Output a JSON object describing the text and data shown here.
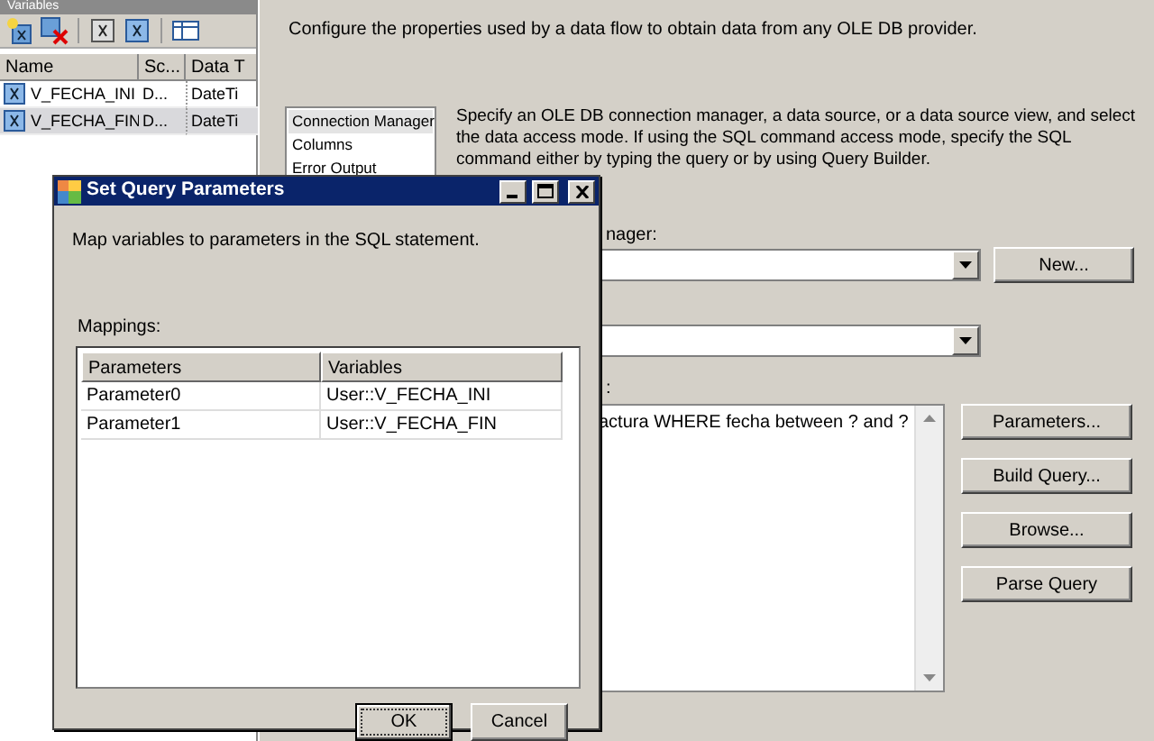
{
  "variables_panel": {
    "title": "Variables",
    "columns": [
      "Name",
      "Sc...",
      "Data T"
    ],
    "rows": [
      {
        "name": "V_FECHA_INI",
        "scope": "D...",
        "data_type": "DateTi",
        "selected": false
      },
      {
        "name": "V_FECHA_FIN",
        "scope": "D...",
        "data_type": "DateTi",
        "selected": true
      }
    ]
  },
  "editor": {
    "description": "Configure the properties used by a data flow to obtain data from any OLE DB provider.",
    "pages": [
      {
        "label": "Connection Manager",
        "selected": true
      },
      {
        "label": "Columns",
        "selected": false
      },
      {
        "label": "Error Output",
        "selected": false
      }
    ],
    "page_help": "Specify an OLE DB connection manager, a data source, or a data source view, and select the data access mode. If using the SQL command access mode, specify the SQL command either by typing the query or by using Query Builder.",
    "connection_label": "nager:",
    "new_button": "New...",
    "command_label": ":",
    "sql_text": "actura WHERE fecha between ? and ?",
    "buttons": [
      "Parameters...",
      "Build Query...",
      "Browse...",
      "Parse Query"
    ]
  },
  "dialog": {
    "title": "Set Query Parameters",
    "message": "Map variables to parameters in the SQL statement.",
    "mappings_label": "Mappings:",
    "columns": [
      "Parameters",
      "Variables"
    ],
    "rows": [
      {
        "parameter": "Parameter0",
        "variable": "User::V_FECHA_INI"
      },
      {
        "parameter": "Parameter1",
        "variable": "User::V_FECHA_FIN"
      }
    ],
    "buttons": [
      {
        "label": "OK",
        "default": true
      },
      {
        "label": "Cancel",
        "default": false
      }
    ]
  }
}
